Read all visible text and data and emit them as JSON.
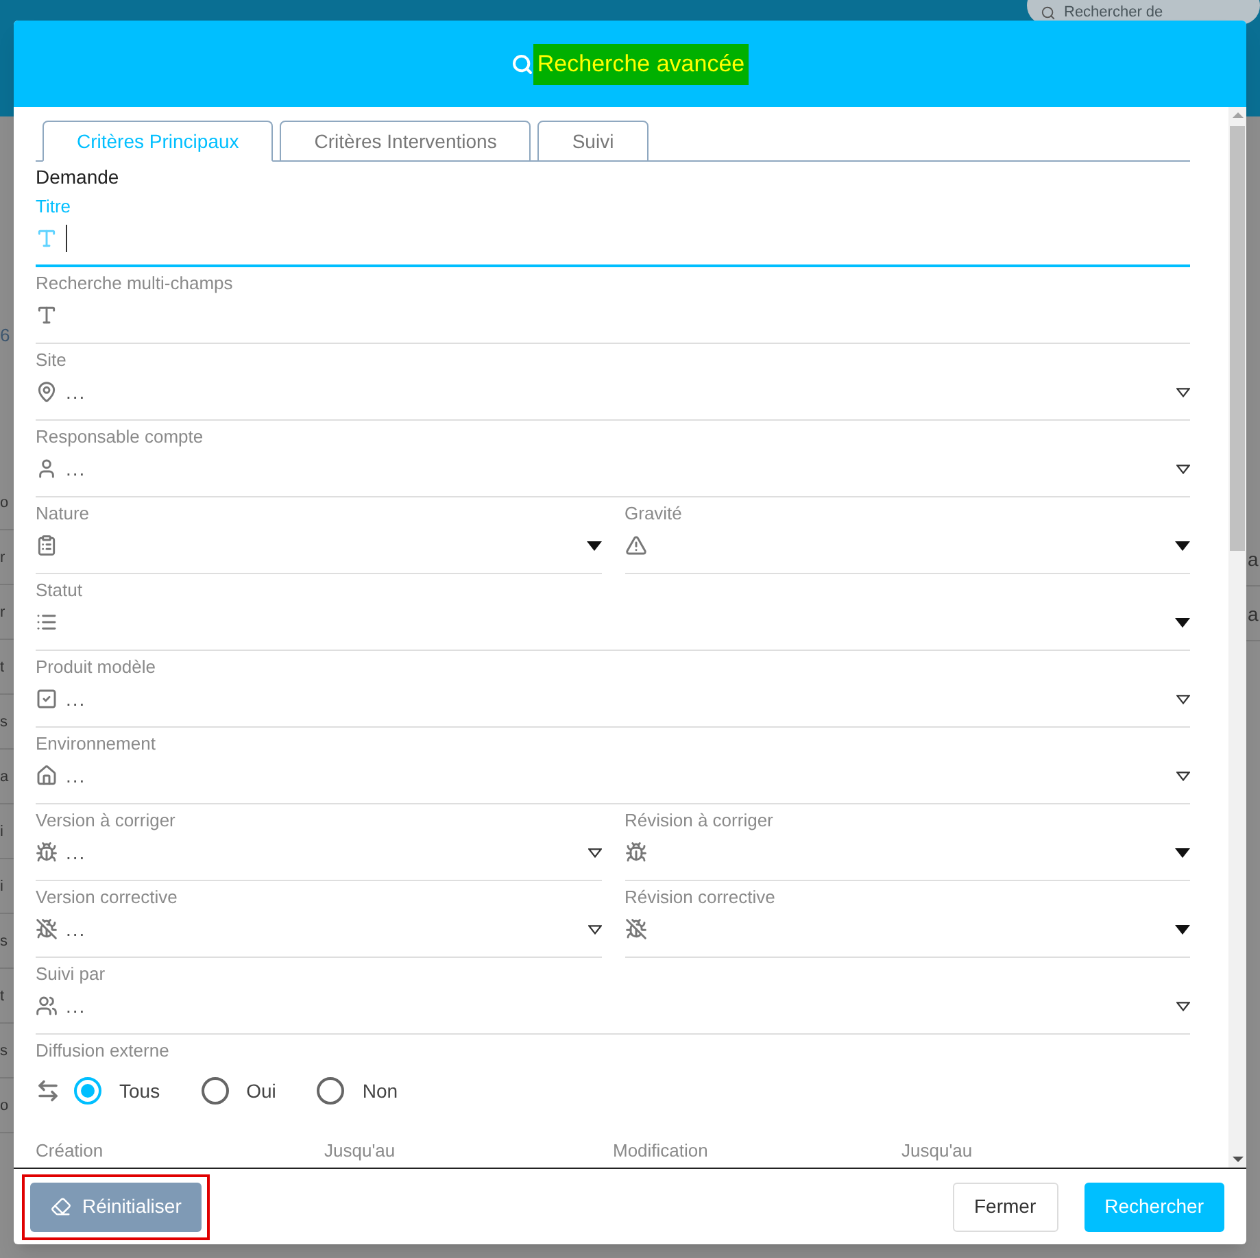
{
  "background": {
    "search": {
      "placeholder": "Rechercher de"
    },
    "number": "6",
    "left_fragments": [
      "o",
      "r",
      "r",
      "t",
      "s",
      "a",
      "i",
      "i",
      "s",
      "t",
      "s",
      "o"
    ],
    "right_fragments": [
      "a",
      "a"
    ]
  },
  "dialog": {
    "title": "Recherche avancée",
    "tabs": [
      {
        "label": "Critères Principaux",
        "selected": true
      },
      {
        "label": "Critères Interventions",
        "selected": false
      },
      {
        "label": "Suivi",
        "selected": false
      }
    ],
    "section": "Demande",
    "fields": [
      {
        "cells": [
          {
            "label": "Titre",
            "kind": "text",
            "focused": true
          }
        ]
      },
      {
        "cells": [
          {
            "label": "Recherche multi-champs",
            "kind": "text",
            "focused": false
          }
        ]
      },
      {
        "cells": [
          {
            "label": "Site",
            "value": "...",
            "kind": "picker",
            "focused": false
          }
        ]
      },
      {
        "cells": [
          {
            "label": "Responsable compte",
            "value": "...",
            "kind": "picker",
            "focused": false
          }
        ]
      },
      {
        "cells": [
          {
            "label": "Nature",
            "kind": "select",
            "focused": false
          },
          {
            "label": "Gravité",
            "kind": "select",
            "focused": false
          }
        ]
      },
      {
        "cells": [
          {
            "label": "Statut",
            "kind": "select",
            "focused": false
          }
        ]
      },
      {
        "cells": [
          {
            "label": "Produit modèle",
            "value": "...",
            "kind": "picker",
            "focused": false
          }
        ]
      },
      {
        "cells": [
          {
            "label": "Environnement",
            "value": "...",
            "kind": "picker",
            "focused": false
          }
        ]
      },
      {
        "cells": [
          {
            "label": "Version à corriger",
            "value": "...",
            "kind": "picker",
            "focused": false
          },
          {
            "label": "Révision à corriger",
            "kind": "select",
            "focused": false
          }
        ]
      },
      {
        "cells": [
          {
            "label": "Version corrective",
            "value": "...",
            "kind": "picker",
            "focused": false
          },
          {
            "label": "Révision corrective",
            "kind": "select",
            "focused": false
          }
        ]
      },
      {
        "cells": [
          {
            "label": "Suivi par",
            "value": "...",
            "kind": "picker",
            "focused": false
          }
        ]
      }
    ],
    "diffusion": {
      "label": "Diffusion externe",
      "options": [
        {
          "label": "Tous",
          "selected": true
        },
        {
          "label": "Oui",
          "selected": false
        },
        {
          "label": "Non",
          "selected": false
        }
      ]
    },
    "date_fields": [
      "Création",
      "Jusqu'au",
      "Modification",
      "Jusqu'au"
    ],
    "buttons": [
      {
        "label": "Réinitialiser",
        "kind": "reset",
        "outlined": true
      },
      {
        "label": "Fermer",
        "kind": "secondary",
        "outlined": false
      },
      {
        "label": "Rechercher",
        "kind": "primary",
        "outlined": false
      }
    ]
  }
}
